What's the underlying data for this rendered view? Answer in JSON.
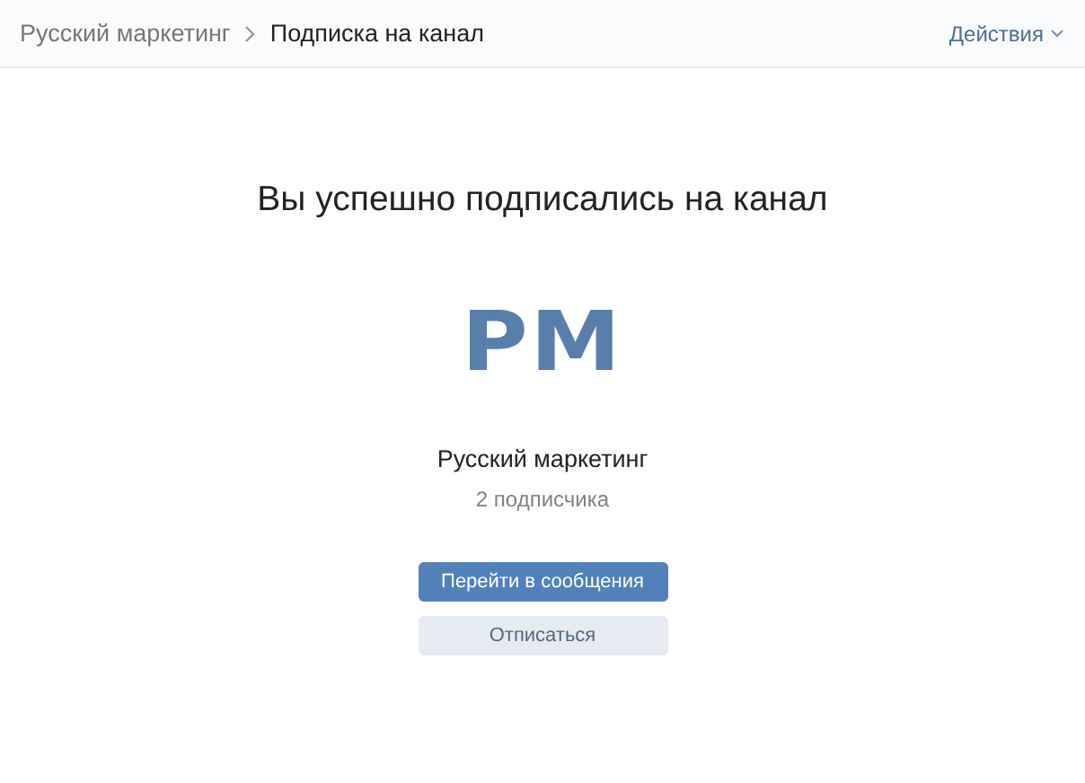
{
  "breadcrumbs": [
    {
      "label": "Русский маркетинг",
      "current": false
    },
    {
      "label": "Подписка на канал",
      "current": true
    }
  ],
  "actions": {
    "label": "Действия"
  },
  "heading": "Вы успешно подписались на канал",
  "channel": {
    "logo": "РМ",
    "name": "Русский маркетинг",
    "subscribers": "2 подписчика"
  },
  "buttons": [
    {
      "label": "Перейти в сообщения",
      "kind": "primary"
    },
    {
      "label": "Отписаться",
      "kind": "secondary"
    }
  ]
}
